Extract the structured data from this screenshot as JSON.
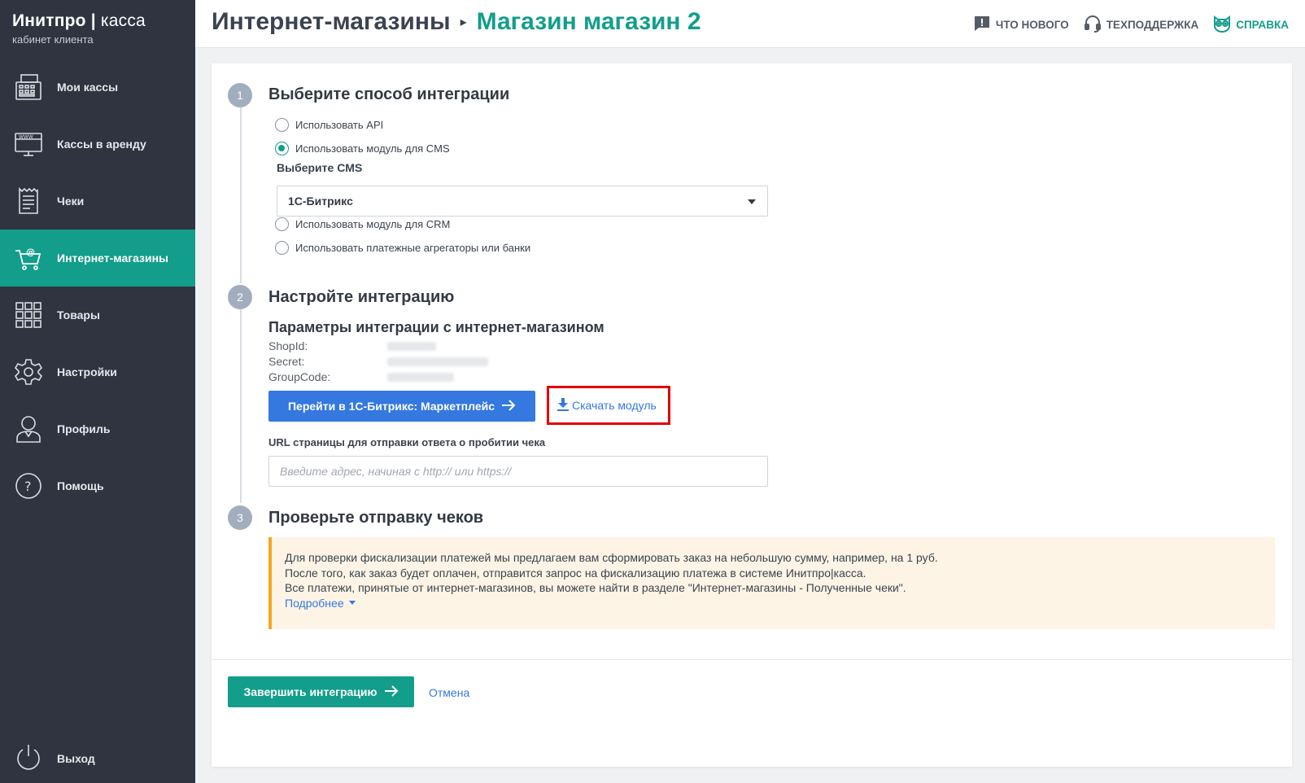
{
  "brand": {
    "name": "Инитпро",
    "name_sep": "|",
    "name_suffix": "касса",
    "subtitle": "кабинет клиента"
  },
  "sidebar": {
    "items": [
      {
        "label": "Мои кассы",
        "icon": "cash-register-icon"
      },
      {
        "label": "Кассы в аренду",
        "icon": "www-monitor-icon"
      },
      {
        "label": "Чеки",
        "icon": "receipt-icon"
      },
      {
        "label": "Интернет-магазины",
        "icon": "cart-at-icon",
        "active": true
      },
      {
        "label": "Товары",
        "icon": "grid-icon"
      },
      {
        "label": "Настройки",
        "icon": "gear-icon"
      },
      {
        "label": "Профиль",
        "icon": "user-icon"
      },
      {
        "label": "Помощь",
        "icon": "help-icon"
      }
    ],
    "logout_label": "Выход"
  },
  "header": {
    "breadcrumb_parent": "Интернет-магазины",
    "breadcrumb_current": "Магазин магазин 2",
    "links": {
      "whats_new": "ЧТО НОВОГО",
      "support": "ТЕХПОДДЕРЖКА",
      "help": "СПРАВКА"
    }
  },
  "step1": {
    "number": "1",
    "title": "Выберите способ интеграции",
    "options": {
      "api": "Использовать API",
      "cms": "Использовать модуль для CMS",
      "crm": "Использовать модуль для CRM",
      "aggregators": "Использовать платежные агрегаторы или банки"
    },
    "selected": "cms",
    "cms_label": "Выберите CMS",
    "cms_value": "1С-Битрикс"
  },
  "step2": {
    "number": "2",
    "title": "Настройте интеграцию",
    "subtitle": "Параметры интеграции с интернет-магазином",
    "params": {
      "shopid_label": "ShopId:",
      "secret_label": "Secret:",
      "groupcode_label": "GroupCode:"
    },
    "marketplace_button": "Перейти в 1С-Битрикс: Маркетплейс",
    "download_link": "Скачать модуль",
    "url_label": "URL страницы для отправки ответа о пробитии чека",
    "url_placeholder": "Введите адрес, начиная с http:// или https://"
  },
  "step3": {
    "number": "3",
    "title": "Проверьте отправку чеков",
    "notice_lines": [
      "Для проверки фискализации платежей мы предлагаем вам сформировать заказ на небольшую сумму, например, на 1 руб.",
      "После того, как заказ будет оплачен, отправится запрос на фискализацию платежа в системе Инитпро|касса.",
      "Все платежи, принятые от интернет-магазинов, вы можете найти в разделе \"Интернет-магазины - Полученные чеки\"."
    ],
    "more_link": "Подробнее"
  },
  "footer": {
    "finish_button": "Завершить интеграцию",
    "cancel_link": "Отмена"
  },
  "colors": {
    "sidebar_bg": "#2f3440",
    "accent_green": "#129e8b",
    "link_blue": "#3478e0",
    "notice_bg": "#fdf4e5",
    "notice_border": "#f5a623",
    "highlight_red": "#e30000"
  }
}
